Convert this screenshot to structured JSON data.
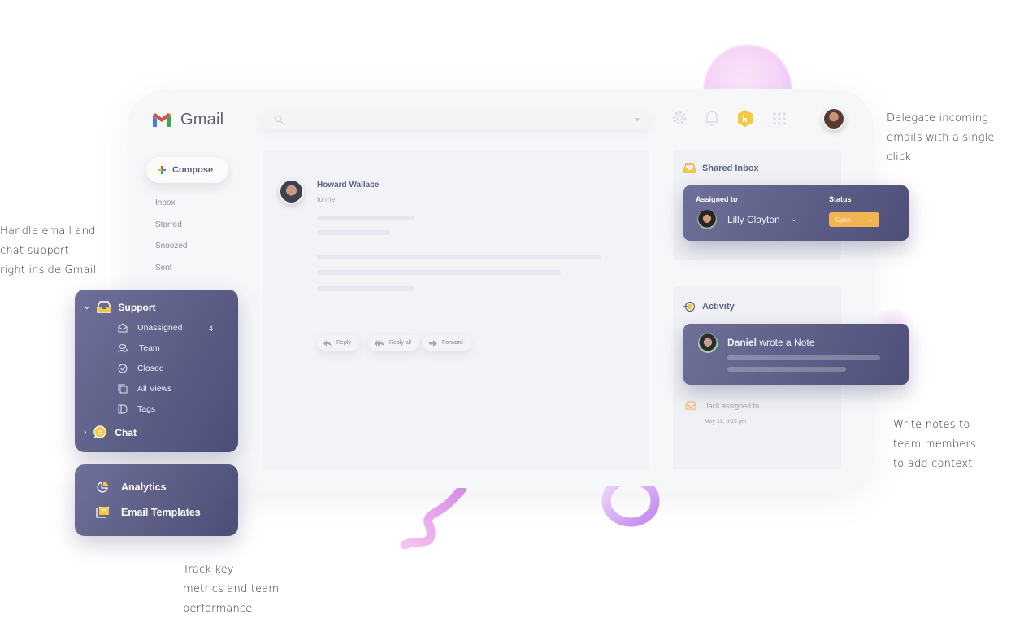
{
  "app": {
    "title": "Gmail"
  },
  "search": {
    "placeholder": ""
  },
  "toolbar": {
    "icons": [
      "gear-icon",
      "bell-icon",
      "hiver-logo-icon",
      "apps-grid-icon",
      "user-avatar"
    ]
  },
  "sidebar": {
    "compose_label": "Compose",
    "items": [
      {
        "label": "Inbox"
      },
      {
        "label": "Starred"
      },
      {
        "label": "Snoozed"
      },
      {
        "label": "Sent"
      }
    ]
  },
  "email": {
    "sender": "Howard Wallace",
    "recipient": "to me",
    "actions": [
      {
        "label": "Reply",
        "icon": "reply-icon"
      },
      {
        "label": "Reply all",
        "icon": "reply-all-icon"
      },
      {
        "label": "Forward",
        "icon": "forward-icon"
      }
    ]
  },
  "shared_inbox": {
    "title": "Shared Inbox",
    "assigned_to_label": "Assigned to",
    "assignee": "Lilly Clayton",
    "status_label": "Status",
    "status_value": "Open",
    "status_color": "#f2b451"
  },
  "activity": {
    "title": "Activity",
    "note": {
      "author": "Daniel",
      "text": " wrote a Note"
    },
    "event": {
      "actor": "Jack",
      "text": "assigned to",
      "time": "May 11, 8:15 pm"
    }
  },
  "support_panel": {
    "group": "Support",
    "items": [
      {
        "label": "Unassigned",
        "count": "4"
      },
      {
        "label": "Team"
      },
      {
        "label": "Closed"
      },
      {
        "label": "All Views"
      },
      {
        "label": "Tags"
      }
    ],
    "chat": "Chat"
  },
  "tools_panel": {
    "items": [
      {
        "label": "Analytics"
      },
      {
        "label": "Email Templates"
      }
    ]
  },
  "captions": {
    "left": [
      "Handle email and",
      "chat support",
      "right inside Gmail"
    ],
    "top_right": [
      "Delegate incoming",
      "emails with a single",
      "click"
    ],
    "bottom_right": [
      "Write notes to",
      "team members",
      "to add context"
    ],
    "bottom": [
      "Track key",
      "metrics and team",
      "performance"
    ]
  },
  "colors": {
    "panel": "#5d5f87",
    "accent_yellow": "#f5c842",
    "background": "#f6f7f9"
  }
}
